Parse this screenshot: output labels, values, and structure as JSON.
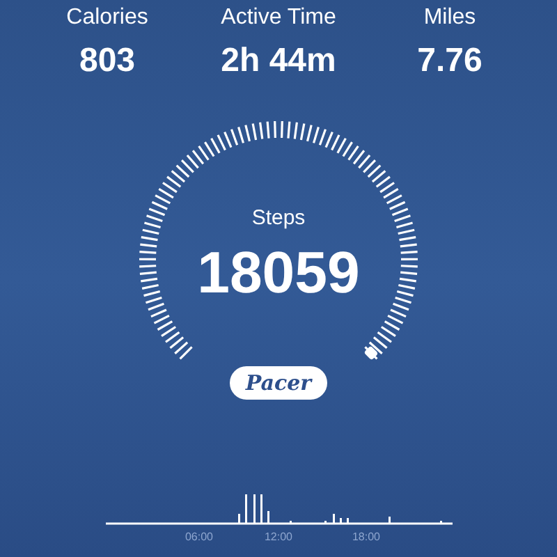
{
  "stats": [
    {
      "label": "Calories",
      "value": "803"
    },
    {
      "label": "Active Time",
      "value": "2h 44m"
    },
    {
      "label": "Miles",
      "value": "7.76"
    }
  ],
  "gauge": {
    "label": "Steps",
    "value": "18059"
  },
  "logo": "Pacer",
  "activity_chart": {
    "x_labels": [
      "06:00",
      "12:00",
      "18:00"
    ]
  }
}
